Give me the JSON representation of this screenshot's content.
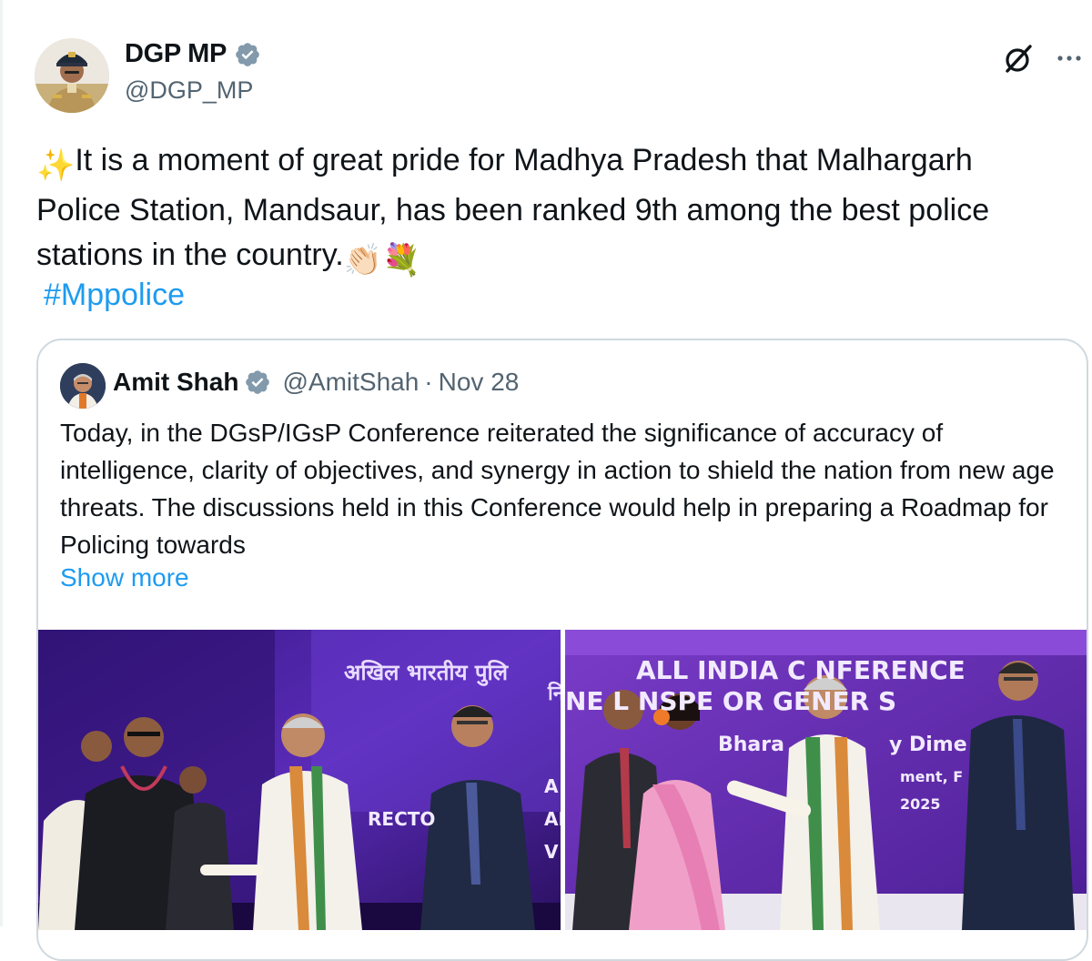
{
  "author": {
    "display_name": "DGP MP",
    "handle": "@DGP_MP",
    "verified": true
  },
  "actions": {
    "grok_icon": "grok-icon",
    "more_icon": "more-icon"
  },
  "tweet": {
    "text": "It is a moment of great pride for Madhya Pradesh that Malhargarh Police Station, Mandsaur, has been ranked 9th among the best police stations in the country.",
    "leading_emoji": "✨",
    "trailing_emojis": "👏🏻💐",
    "hashtag": "#Mppolice"
  },
  "quoted_tweet": {
    "display_name": "Amit Shah",
    "handle": "@AmitShah",
    "separator": "·",
    "date": "Nov 28",
    "verified": true,
    "text": "Today, in the DGsP/IGsP Conference reiterated the significance of accuracy of intelligence, clarity of objectives, and synergy in action to shield the nation from new age threats. The discussions held in this Conference would help in preparing a Roadmap for Policing towards",
    "show_more": "Show more",
    "photos": [
      {
        "banner_lines": [
          "अखिल भारतीय पुलि",
          "नि",
          "RECTO",
          "A",
          "AL",
          "V"
        ]
      },
      {
        "banner_lines": [
          "ALL INDIA C  NFERENCE",
          "NE  L  NSPE  OR GENER  S",
          "Bhara",
          "y Dime",
          "ment, F",
          "2025"
        ]
      }
    ]
  },
  "colors": {
    "accent": "#1d9bf0",
    "verified": "#829aab",
    "text": "#0f1419",
    "secondary": "#536471",
    "border": "#cfd9de"
  }
}
